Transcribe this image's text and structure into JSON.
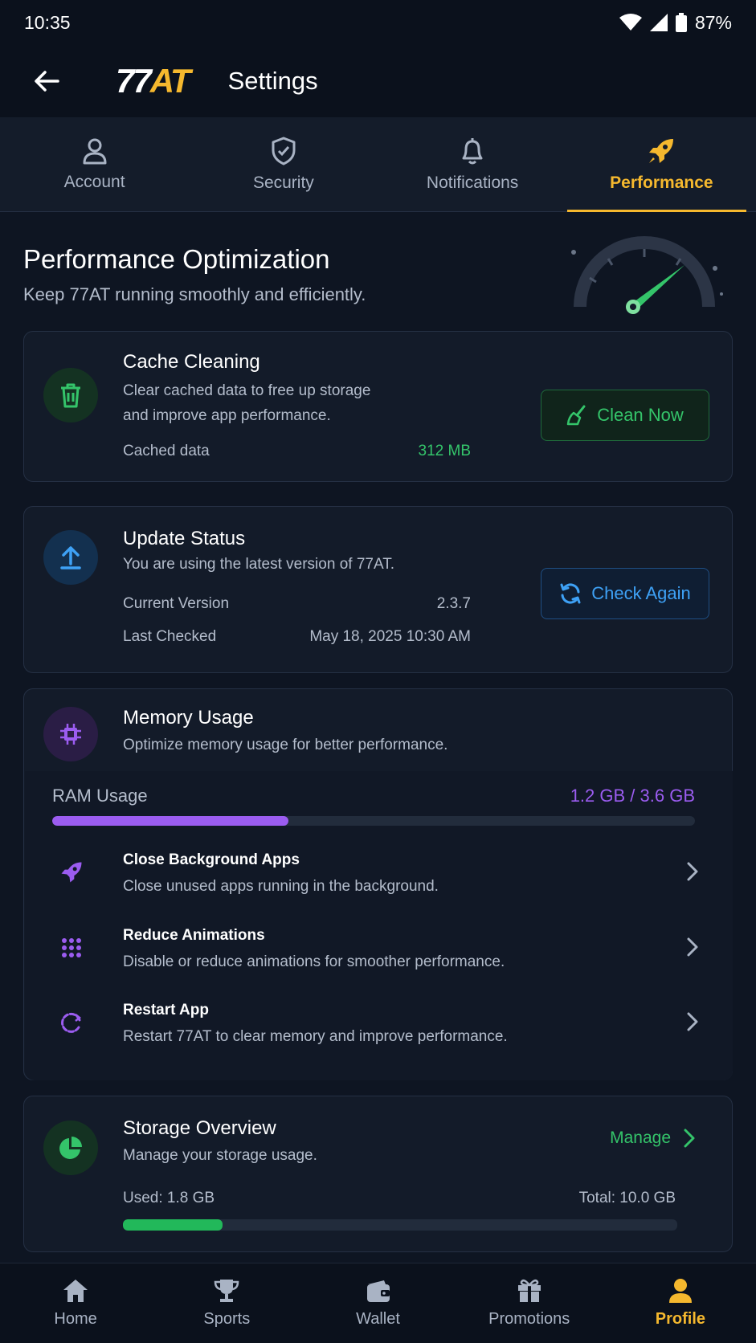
{
  "status_bar": {
    "time": "10:35",
    "battery": "87%"
  },
  "header": {
    "logo_part1": "77",
    "logo_part2": "AT",
    "title": "Settings"
  },
  "tabs": [
    {
      "label": "Account",
      "icon": "person-icon",
      "active": false
    },
    {
      "label": "Security",
      "icon": "shield-icon",
      "active": false
    },
    {
      "label": "Notifications",
      "icon": "bell-icon",
      "active": false
    },
    {
      "label": "Performance",
      "icon": "rocket-icon",
      "active": true
    }
  ],
  "hero": {
    "title": "Performance Optimization",
    "subtitle": "Keep 77AT running smoothly and efficiently."
  },
  "cache": {
    "title": "Cache Cleaning",
    "desc_line1": "Clear cached data to free up storage",
    "desc_line2": "and improve app performance.",
    "label": "Cached data",
    "value": "312 MB",
    "button": "Clean Now"
  },
  "update": {
    "title": "Update Status",
    "desc": "You are using the latest version of 77AT.",
    "version_label": "Current Version",
    "version_value": "2.3.7",
    "checked_label": "Last Checked",
    "checked_value": "May 18, 2025 10:30 AM",
    "button": "Check Again"
  },
  "memory": {
    "title": "Memory Usage",
    "desc": "Optimize memory usage for better performance.",
    "ram_label": "RAM Usage",
    "ram_value": "1.2 GB / 3.6 GB",
    "ram_fraction": 0.367,
    "items": [
      {
        "title": "Close Background Apps",
        "desc": "Close unused apps running in the background.",
        "icon": "rocket-icon"
      },
      {
        "title": "Reduce Animations",
        "desc": "Disable or reduce animations for smoother performance.",
        "icon": "dots-grid-icon"
      },
      {
        "title": "Restart App",
        "desc": "Restart 77AT to clear memory and improve performance.",
        "icon": "restart-icon"
      }
    ]
  },
  "storage": {
    "title": "Storage Overview",
    "desc": "Manage your storage usage.",
    "manage": "Manage",
    "used": "Used: 1.8 GB",
    "total": "Total: 10.0 GB",
    "used_fraction": 0.18
  },
  "bottom_nav": [
    {
      "label": "Home",
      "icon": "home-icon",
      "active": false
    },
    {
      "label": "Sports",
      "icon": "trophy-icon",
      "active": false
    },
    {
      "label": "Wallet",
      "icon": "wallet-icon",
      "active": false
    },
    {
      "label": "Promotions",
      "icon": "gift-icon",
      "active": false
    },
    {
      "label": "Profile",
      "icon": "profile-icon",
      "active": true
    }
  ],
  "colors": {
    "accent": "#f5b82e",
    "green": "#34c46a",
    "blue": "#3ea1f5",
    "purple": "#9b5cf0"
  }
}
